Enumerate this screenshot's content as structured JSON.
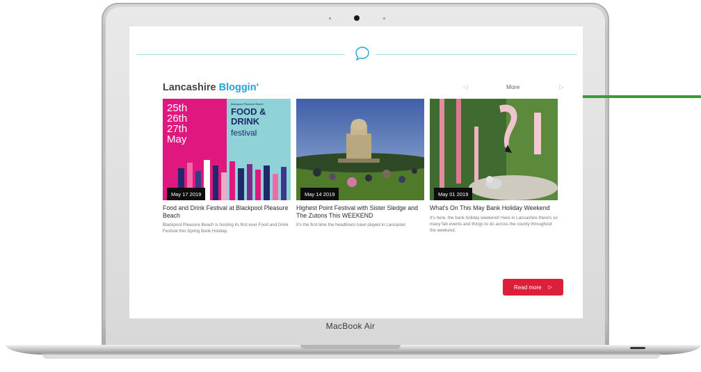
{
  "device": {
    "model": "MacBook Air"
  },
  "blog": {
    "title_part1": "Lancashire",
    "title_part2": "Bloggin'",
    "nav": {
      "prev": "◁",
      "more": "More",
      "next": "▷"
    },
    "read_more": "Read more",
    "read_more_arrow": "▷",
    "posts": [
      {
        "date": "May 17 2019",
        "title": "Food and Drink Festival at Blackpool Pleasure Beach",
        "excerpt": "Blackpool Pleasure Beach is hosting its first ever Food and Drink Festival this Spring Bank Holiday.",
        "poster": {
          "dates": [
            "25th",
            "26th",
            "27th",
            "May"
          ],
          "small": "Blackpool Pleasure Beach",
          "big1": "FOOD &",
          "big2": "DRINK",
          "big3": "festival"
        }
      },
      {
        "date": "May 14 2019",
        "title": "Highest Point Festival with Sister Sledge and The Zutons This WEEKEND",
        "excerpt": "It's the first time the headliners have played in Lancaster."
      },
      {
        "date": "May 01 2019",
        "title": "What's On This May Bank Holiday Weekend",
        "excerpt": "It's here, the bank holiday weekend! Here in Lancashire there's so many fab events and things to do across the county throughout the weekend."
      }
    ]
  },
  "colors": {
    "accent": "#1fa6d9",
    "button": "#dc1f3b",
    "arrow": "#3a9b32"
  }
}
